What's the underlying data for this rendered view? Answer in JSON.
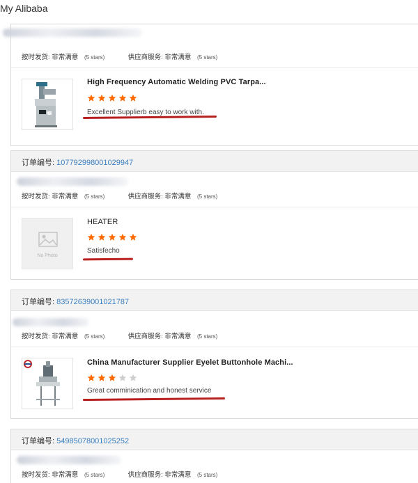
{
  "page": {
    "title": "My Alibaba"
  },
  "labels": {
    "order_prefix": "订单编号:",
    "on_time": "按时发货:",
    "supplier_service": "供应商服务:",
    "very_satisfied": "非常满意",
    "five_stars": "(5 stars)",
    "no_photo": "No Photo"
  },
  "orders": [
    {
      "order_number": "",
      "product": "High Frequency Automatic Welding PVC Tarpa...",
      "stars": 5,
      "feedback": "Excellent Supplierb easy to work with."
    },
    {
      "order_number": "107792998001029947",
      "product": "HEATER",
      "stars": 5,
      "feedback": "Satisfecho"
    },
    {
      "order_number": "83572639001021787",
      "product": "China Manufacturer Supplier Eyelet Buttonhole Machi...",
      "stars": 3,
      "feedback": "Great comminication and honest service"
    },
    {
      "order_number": "54985078001025252"
    }
  ],
  "colors": {
    "star_on": "#ff6a00",
    "star_off": "#cfcfcf",
    "link": "#3a7fc1",
    "annotation": "#b81f1f"
  },
  "icons": [
    "star-icon",
    "no-photo-icon",
    "welding-machine-photo",
    "buttonhole-machine-photo"
  ]
}
